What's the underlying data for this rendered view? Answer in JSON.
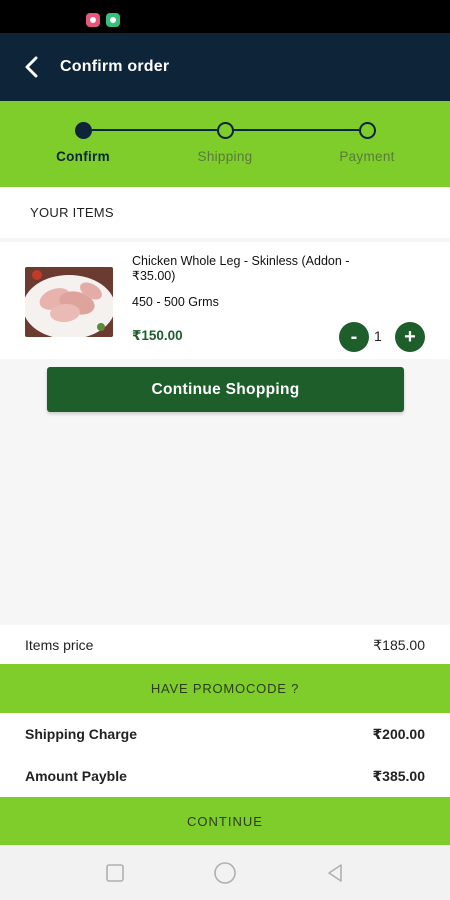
{
  "header": {
    "title": "Confirm order",
    "back_icon": "back-arrow-icon"
  },
  "stepper": {
    "steps": [
      {
        "label": "Confirm",
        "active": true
      },
      {
        "label": "Shipping",
        "active": false
      },
      {
        "label": "Payment",
        "active": false
      }
    ]
  },
  "section": {
    "title": "YOUR ITEMS"
  },
  "cart": {
    "items": [
      {
        "name": "Chicken Whole Leg - Skinless (Addon - ₹35.00)",
        "weight": "450 - 500 Grms",
        "price": "₹150.00",
        "quantity": "1",
        "minus_label": "-",
        "plus_label": "+",
        "image_icon": "chicken-leg-photo"
      }
    ]
  },
  "actions": {
    "continue_shopping": "Continue Shopping",
    "promo": "HAVE PROMOCODE ?",
    "continue": "CONTINUE"
  },
  "summary": {
    "items_price_label": "Items price",
    "items_price_value": "₹185.00",
    "shipping_label": "Shipping Charge",
    "shipping_value": "₹200.00",
    "amount_label": "Amount Payble",
    "amount_value": "₹385.00"
  },
  "colors": {
    "primary_dark": "#0e2438",
    "accent_green": "#7ecd2a",
    "button_green": "#1d5e2b"
  }
}
